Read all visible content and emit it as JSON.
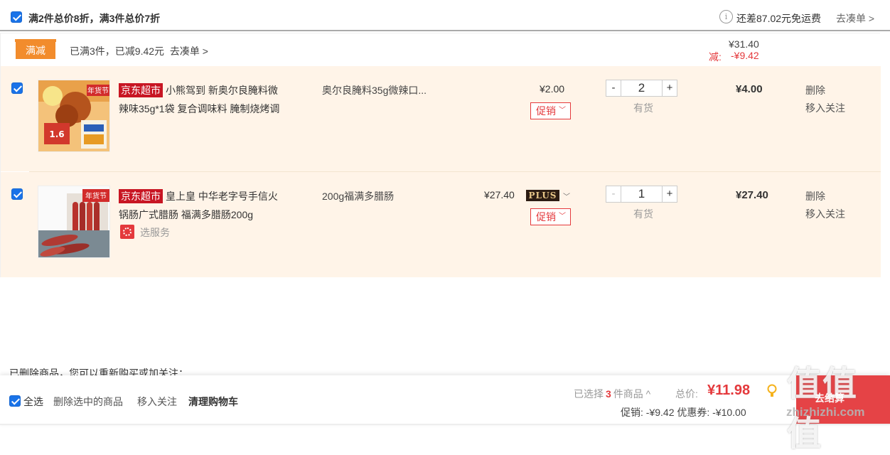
{
  "header": {
    "rule_text": "满2件总价8折，满3件总价7折",
    "shipping_text": "还差87.02元免运费",
    "shipping_link": "去凑单 >"
  },
  "promo": {
    "tag": "满减",
    "description": "已满3件，已减9.42元",
    "link": "去凑单 >",
    "sum": "¥31.40",
    "cut_label": "减:",
    "cut_value": "-¥9.42"
  },
  "items": [
    {
      "badge": "京东超市",
      "title_line1": "小熊驾到 新奥尔良腌料微",
      "title_line2": "辣味35g*1袋 复合调味料 腌制烧烤调",
      "spec": "奥尔良腌料35g微辣口...",
      "price": "¥2.00",
      "promo_label": "促销",
      "quantity": "2",
      "stock": "有货",
      "subtotal": "¥4.00",
      "op_delete": "删除",
      "op_follow": "移入关注",
      "thumb_tag": "年货节",
      "thumb_num": "1.6"
    },
    {
      "badge": "京东超市",
      "title_line1": "皇上皇 中华老字号手信火",
      "title_line2": "锅肠广式腊肠 福满多腊肠200g",
      "spec": "200g福满多腊肠",
      "price": "¥27.40",
      "plus_badge": "PLUS",
      "promo_label": "促销",
      "service": "选服务",
      "quantity": "1",
      "stock": "有货",
      "subtotal": "¥27.40",
      "op_delete": "删除",
      "op_follow": "移入关注",
      "thumb_tag": "年货节"
    }
  ],
  "deleted_note": "已删除商品，您可以重新购买或加关注：",
  "footer": {
    "select_all": "全选",
    "delete_selected": "删除选中的商品",
    "move_follow": "移入关注",
    "clear_cart": "清理购物车",
    "selected_prefix": "已选择",
    "selected_count": "3",
    "selected_suffix": "件商品 ^",
    "total_label": "总价:",
    "total_amount": "¥11.98",
    "discounts": "促销: -¥9.42  优惠券: -¥10.00"
  },
  "watermark": {
    "main": "值值值",
    "sub": "去结算",
    "url": "zhizhizhi.com"
  },
  "colors": {
    "accent_red": "#e4393c",
    "checkbox_blue": "#1a73e8",
    "promo_orange": "#f28c2c",
    "row_bg": "#fff4e8"
  }
}
